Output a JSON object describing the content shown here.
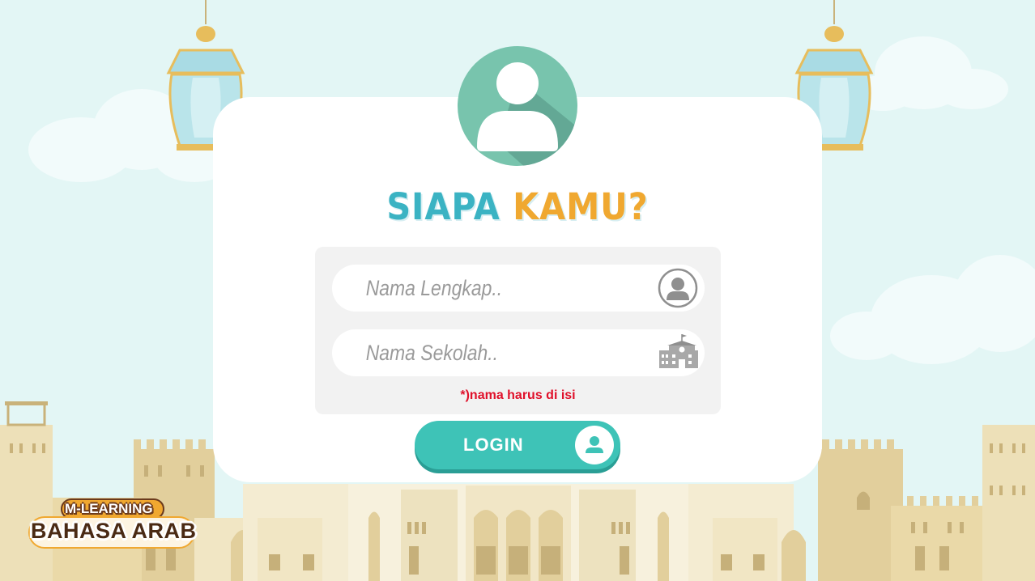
{
  "title": {
    "part1": "SIAPA",
    "part2": "KAMU?"
  },
  "form": {
    "name_placeholder": "Nama Lengkap..",
    "school_placeholder": "Nama Sekolah..",
    "required_note": "*)nama harus di isi"
  },
  "login": {
    "label": "LOGIN"
  },
  "logo": {
    "line1": "M-LEARNING",
    "line2": "BAHASA ARAB"
  },
  "colors": {
    "sky": "#e3f6f5",
    "accent_teal": "#3ec3b7",
    "title_blue": "#3bb3c3",
    "title_orange": "#f0a830",
    "avatar_green": "#78c4ad",
    "error_red": "#e0102a"
  },
  "icons": {
    "avatar": "user-silhouette-icon",
    "name_field": "user-circle-icon",
    "school_field": "school-building-icon",
    "login": "user-icon"
  }
}
